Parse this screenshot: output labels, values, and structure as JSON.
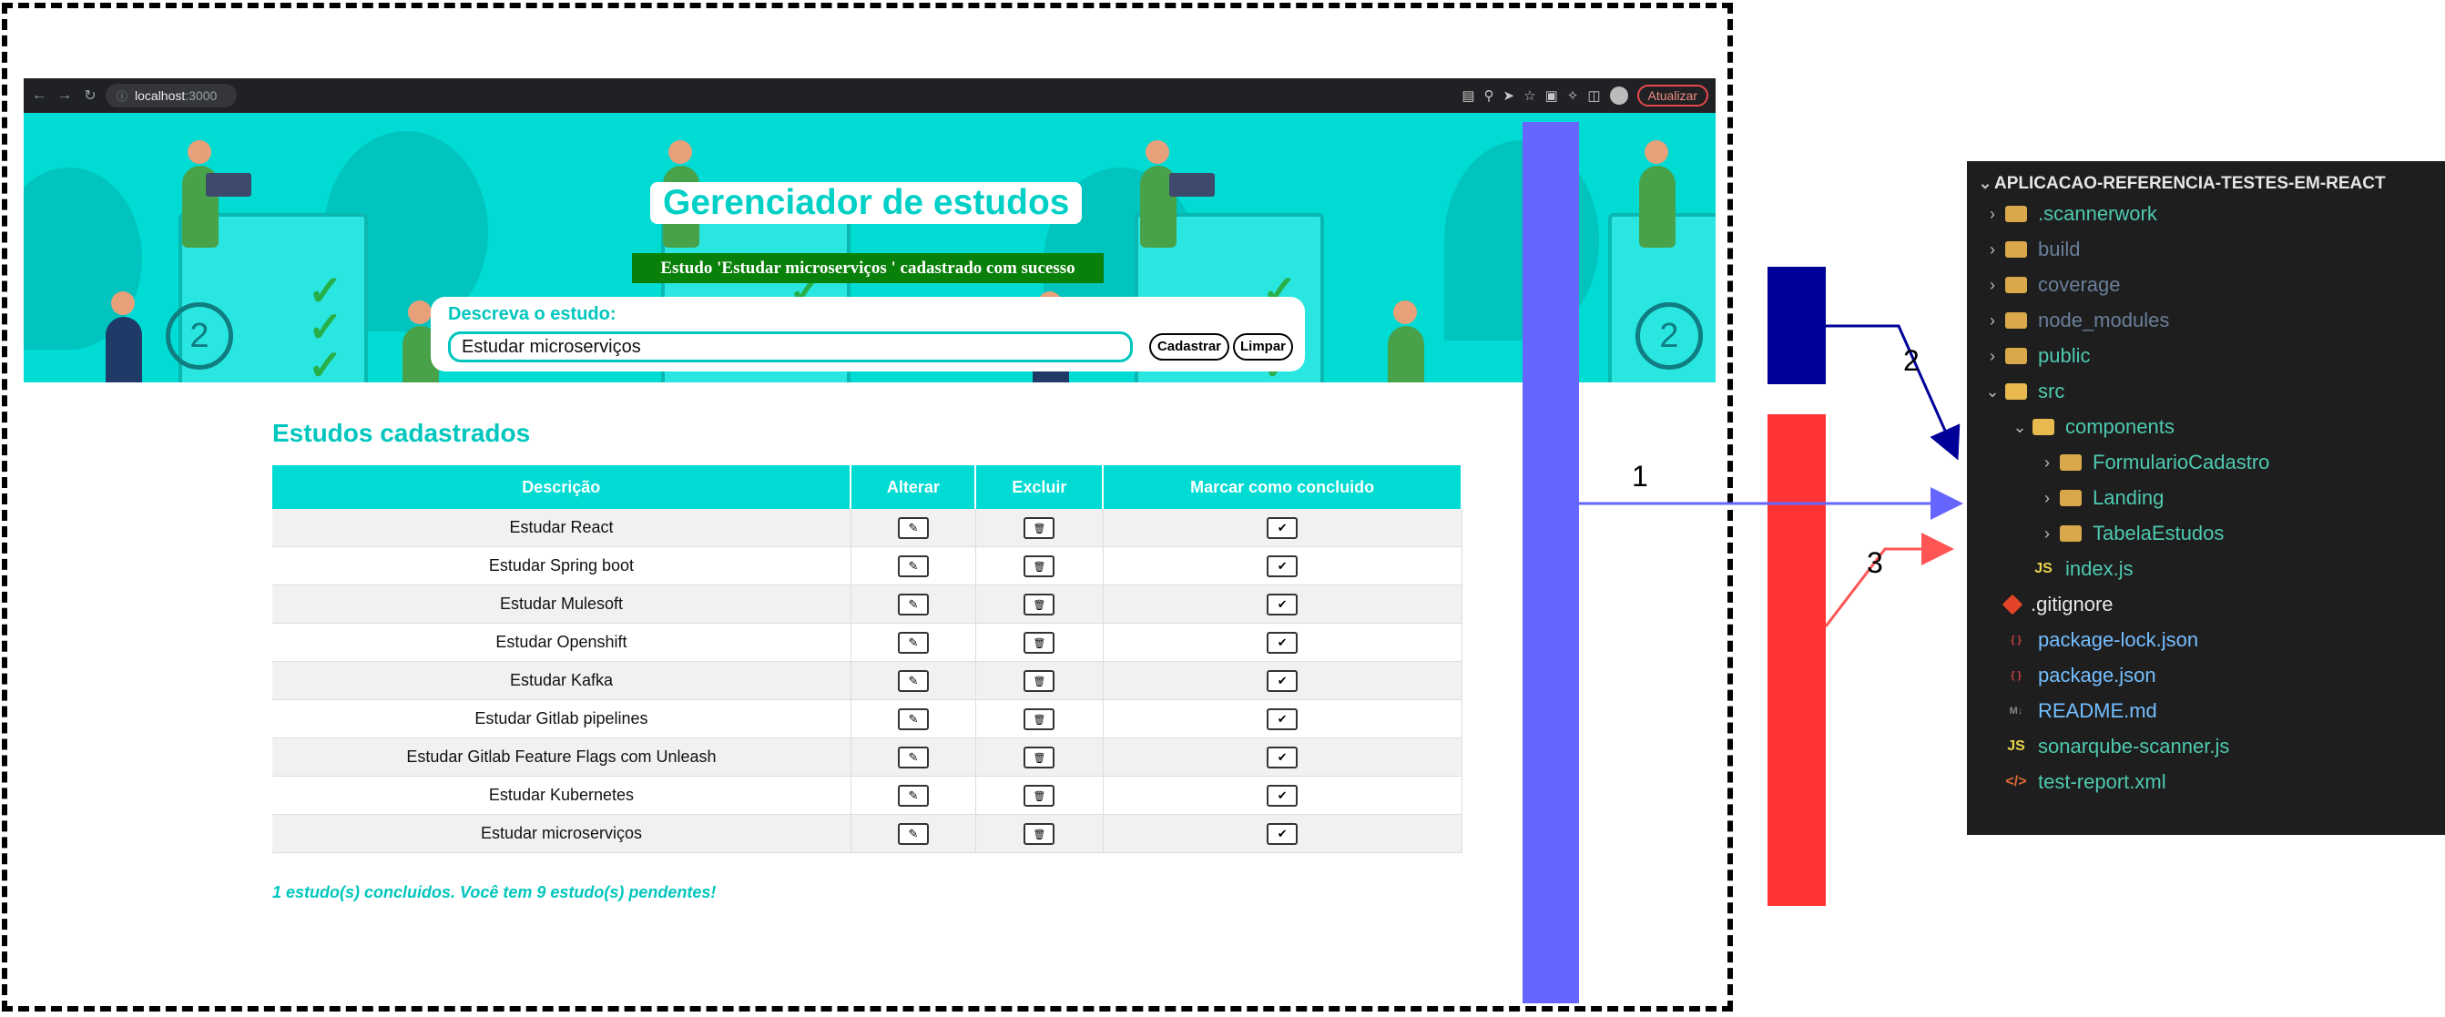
{
  "browser": {
    "url_host": "localhost",
    "url_port": ":3000",
    "update_label": "Atualizar"
  },
  "app": {
    "title": "Gerenciador de estudos",
    "success_message": "Estudo 'Estudar microserviços ' cadastrado com sucesso",
    "form_label": "Descreva o estudo:",
    "input_value": "Estudar microserviços",
    "register_label": "Cadastrar",
    "clear_label": "Limpar",
    "section_title": "Estudos cadastrados",
    "table_headers": [
      "Descrição",
      "Alterar",
      "Excluir",
      "Marcar como concluido"
    ],
    "rows": [
      "Estudar React",
      "Estudar Spring boot",
      "Estudar Mulesoft",
      "Estudar Openshift",
      "Estudar Kafka",
      "Estudar Gitlab pipelines",
      "Estudar Gitlab Feature Flags com Unleash",
      "Estudar Kubernetes",
      "Estudar microserviços"
    ],
    "summary": "1 estudo(s) concluidos. Você tem 9 estudo(s) pendentes!"
  },
  "diagram": {
    "arrow_labels": [
      "1",
      "2",
      "3"
    ],
    "colors": {
      "purple": "#6666ff",
      "navy": "#000099",
      "red": "#ff3333"
    }
  },
  "explorer": {
    "title": "APLICACAO-REFERENCIA-TESTES-EM-REACT",
    "items": [
      {
        "name": ".scannerwork",
        "icon": "folder-icon",
        "color": "#4ec9b0",
        "depth": 0,
        "chevron": "closed"
      },
      {
        "name": "build",
        "icon": "folder-icon",
        "color": "#6a7f9a",
        "depth": 0,
        "chevron": "closed"
      },
      {
        "name": "coverage",
        "icon": "folder-icon",
        "color": "#6a7f9a",
        "depth": 0,
        "chevron": "closed"
      },
      {
        "name": "node_modules",
        "icon": "folder-icon",
        "color": "#6a7f9a",
        "depth": 0,
        "chevron": "closed"
      },
      {
        "name": "public",
        "icon": "folder-icon",
        "color": "#4ec9b0",
        "depth": 0,
        "chevron": "closed"
      },
      {
        "name": "src",
        "icon": "folder-open-icon",
        "color": "#4ec9b0",
        "depth": 0,
        "chevron": "open"
      },
      {
        "name": "components",
        "icon": "folder-open-icon",
        "color": "#4ec9b0",
        "depth": 1,
        "chevron": "open"
      },
      {
        "name": "FormularioCadastro",
        "icon": "folder-icon",
        "color": "#4ec9b0",
        "depth": 2,
        "chevron": "closed"
      },
      {
        "name": "Landing",
        "icon": "folder-icon",
        "color": "#4ec9b0",
        "depth": 2,
        "chevron": "closed"
      },
      {
        "name": "TabelaEstudos",
        "icon": "folder-icon",
        "color": "#4ec9b0",
        "depth": 2,
        "chevron": "closed"
      },
      {
        "name": "index.js",
        "icon": "js-icon",
        "color": "#4ec9b0",
        "depth": 1,
        "chevron": "none"
      },
      {
        "name": ".gitignore",
        "icon": "git-icon",
        "color": "#e6e6e6",
        "depth": 0,
        "chevron": "none"
      },
      {
        "name": "package-lock.json",
        "icon": "json-icon",
        "color": "#75beff",
        "depth": 0,
        "chevron": "none"
      },
      {
        "name": "package.json",
        "icon": "json-icon",
        "color": "#75beff",
        "depth": 0,
        "chevron": "none"
      },
      {
        "name": "README.md",
        "icon": "markdown-icon",
        "color": "#75beff",
        "depth": 0,
        "chevron": "none"
      },
      {
        "name": "sonarqube-scanner.js",
        "icon": "js-icon",
        "color": "#4ec9b0",
        "depth": 0,
        "chevron": "none"
      },
      {
        "name": "test-report.xml",
        "icon": "xml-icon",
        "color": "#4ec9b0",
        "depth": 0,
        "chevron": "none"
      }
    ]
  }
}
